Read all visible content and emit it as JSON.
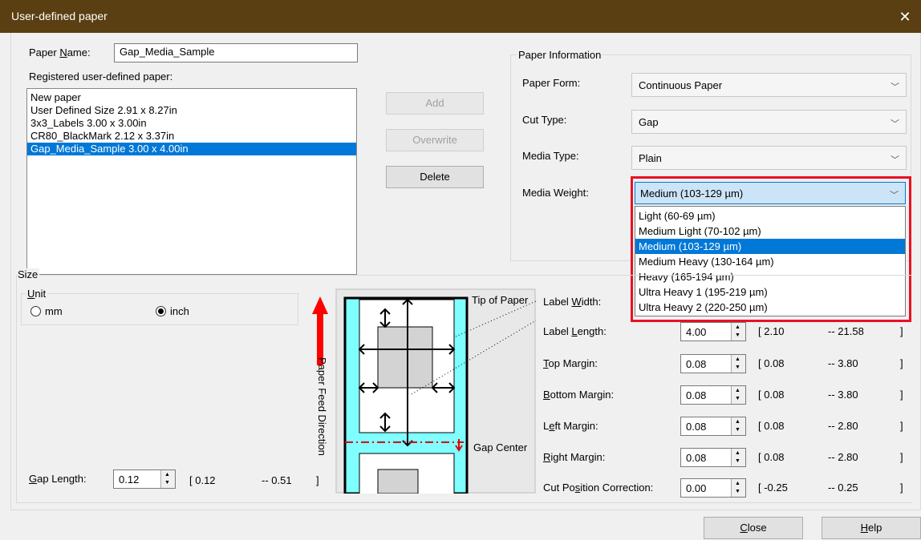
{
  "window": {
    "title": "User-defined paper",
    "close_glyph": "✕"
  },
  "paper_name": {
    "label": "Paper Name:",
    "value": "Gap_Media_Sample"
  },
  "registered": {
    "label": "Registered user-defined paper:",
    "items": [
      {
        "text": "New paper",
        "selected": false
      },
      {
        "text": "User Defined Size 2.91 x 8.27in",
        "selected": false
      },
      {
        "text": "3x3_Labels 3.00 x 3.00in",
        "selected": false
      },
      {
        "text": "CR80_BlackMark 2.12 x 3.37in",
        "selected": false
      },
      {
        "text": "Gap_Media_Sample 3.00 x 4.00in",
        "selected": true
      }
    ]
  },
  "buttons": {
    "add": "Add",
    "overwrite": "Overwrite",
    "delete": "Delete",
    "close": "Close",
    "help": "Help"
  },
  "paper_info": {
    "group_label": "Paper Information",
    "paper_form": {
      "label": "Paper Form:",
      "value": "Continuous Paper"
    },
    "cut_type": {
      "label": "Cut Type:",
      "value": "Gap"
    },
    "media_type": {
      "label": "Media Type:",
      "value": "Plain"
    },
    "media_weight": {
      "label": "Media Weight:",
      "value": "Medium (103-129 µm)",
      "options": [
        {
          "text": "Light (60-69 µm)",
          "selected": false
        },
        {
          "text": "Medium Light (70-102 µm)",
          "selected": false
        },
        {
          "text": "Medium (103-129 µm)",
          "selected": true
        },
        {
          "text": "Medium Heavy (130-164 µm)",
          "selected": false
        },
        {
          "text": "Heavy (165-194 µm)",
          "selected": false
        },
        {
          "text": "Ultra Heavy 1 (195-219 µm)",
          "selected": false
        },
        {
          "text": "Ultra Heavy 2 (220-250 µm)",
          "selected": false
        }
      ]
    }
  },
  "size": {
    "group_label": "Size",
    "unit_label": "Unit",
    "mm": "mm",
    "inch": "inch",
    "selected_unit": "inch",
    "gap_length": {
      "label": "Gap Length:",
      "value": "0.12",
      "min": "[  0.12",
      "max": "--  0.51",
      "close": "]"
    }
  },
  "diagram": {
    "tip_of_paper": "Tip of Paper",
    "gap_center": "Gap Center",
    "feed_direction": "Paper Feed Direction",
    "colors": {
      "paper": "#7fffff",
      "label": "#ffffff",
      "inner": "#d3d3d3",
      "arrow": "#ff0000"
    }
  },
  "fields": [
    {
      "key": "label_width",
      "label": "Label Width:"
    },
    {
      "key": "label_length",
      "label": "Label Length:",
      "value": "4.00",
      "min": "[  2.10",
      "max": "--  21.58",
      "close": "]"
    },
    {
      "key": "top_margin",
      "label": "Top Margin:",
      "value": "0.08",
      "min": "[  0.08",
      "max": "--  3.80",
      "close": "]"
    },
    {
      "key": "bottom_margin",
      "label": "Bottom Margin:",
      "value": "0.08",
      "min": "[  0.08",
      "max": "--  3.80",
      "close": "]"
    },
    {
      "key": "left_margin",
      "label": "Left Margin:",
      "value": "0.08",
      "min": "[  0.08",
      "max": "--  2.80",
      "close": "]"
    },
    {
      "key": "right_margin",
      "label": "Right Margin:",
      "value": "0.08",
      "min": "[  0.08",
      "max": "--  2.80",
      "close": "]"
    },
    {
      "key": "cut_position",
      "label": "Cut Position Correction:",
      "value": "0.00",
      "min": "[  -0.25",
      "max": "--  0.25",
      "close": "]"
    }
  ],
  "colors": {
    "titlebar": "#5a3f12",
    "selection": "#0078d7",
    "highlight_box": "#e81123"
  }
}
